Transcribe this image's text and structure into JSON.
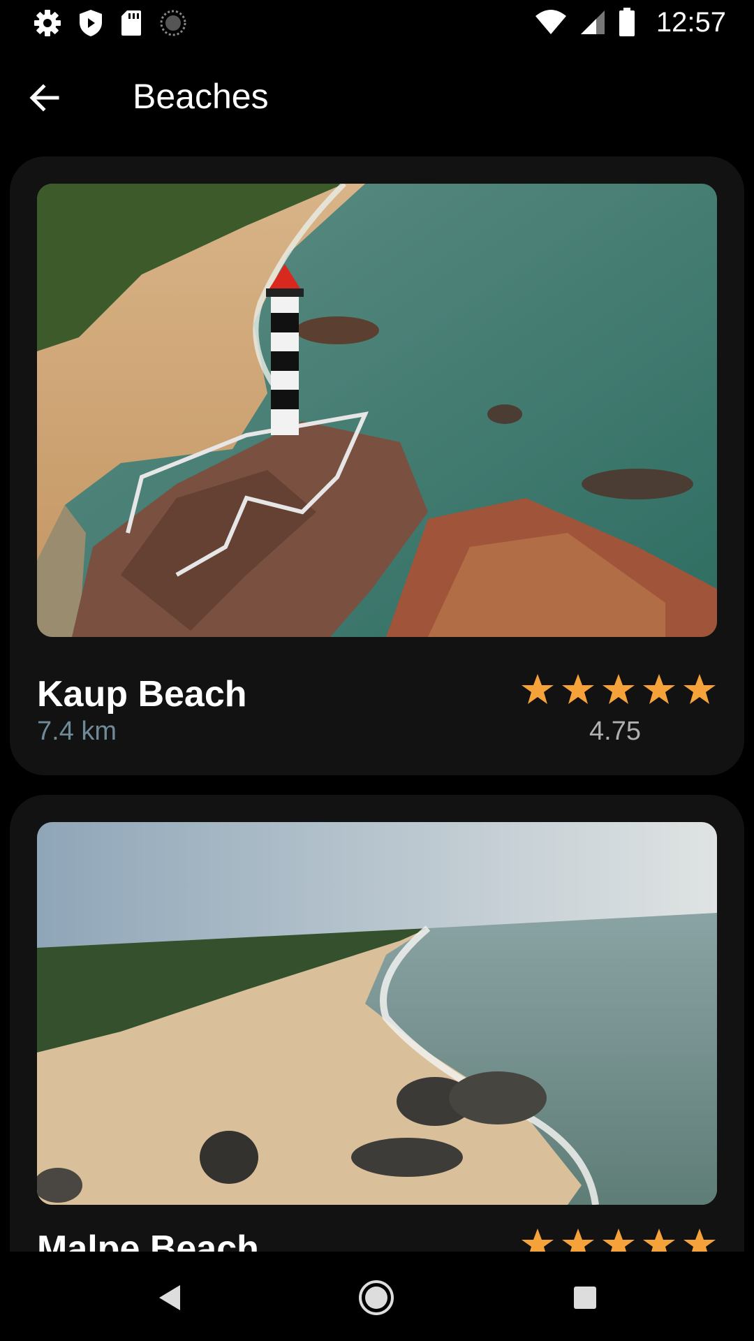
{
  "status_bar": {
    "time": "12:57",
    "icons_left": [
      "gear-icon",
      "shield-icon",
      "sd-card-icon",
      "sync-icon"
    ],
    "icons_right": [
      "wifi-icon",
      "signal-icon",
      "battery-icon"
    ]
  },
  "app_bar": {
    "title": "Beaches",
    "back_icon": "arrow-left-icon"
  },
  "beaches": [
    {
      "name": "Kaup Beach",
      "distance": "7.4 km",
      "rating": "4.75",
      "stars": 5
    },
    {
      "name": "Malpe Beach",
      "distance": "",
      "rating": "",
      "stars": 5
    }
  ],
  "colors": {
    "background": "#000000",
    "card": "#121212",
    "star": "#f5a23a",
    "distance": "#6f8a99"
  },
  "nav_bar": {
    "icons": [
      "nav-back-icon",
      "nav-home-icon",
      "nav-recents-icon"
    ]
  }
}
